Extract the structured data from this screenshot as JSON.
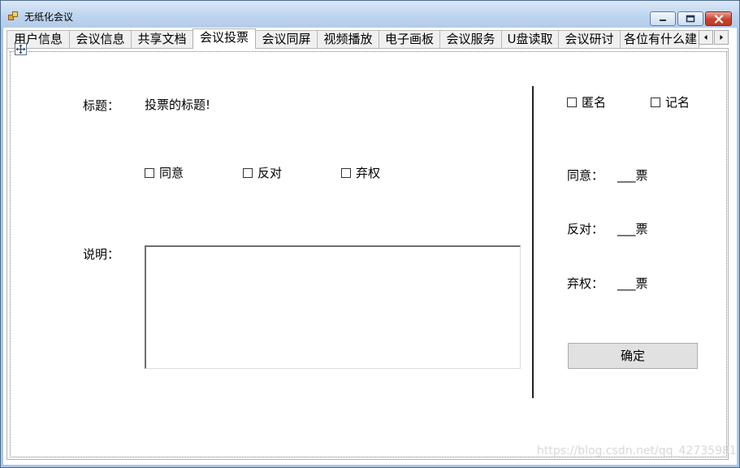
{
  "window": {
    "title": "无纸化会议",
    "icon": "app-icon"
  },
  "tabs": [
    {
      "label": "用户信息",
      "active": false
    },
    {
      "label": "会议信息",
      "active": false
    },
    {
      "label": "共享文档",
      "active": false
    },
    {
      "label": "会议投票",
      "active": true
    },
    {
      "label": "会议同屏",
      "active": false
    },
    {
      "label": "视频播放",
      "active": false
    },
    {
      "label": "电子画板",
      "active": false
    },
    {
      "label": "会议服务",
      "active": false
    },
    {
      "label": "U盘读取",
      "active": false
    },
    {
      "label": "会议研讨",
      "active": false
    },
    {
      "label": "各位有什么建",
      "active": false
    }
  ],
  "vote_form": {
    "title_label": "标题：",
    "title_value": "投票的标题!",
    "options": [
      {
        "label": "同意",
        "checked": false
      },
      {
        "label": "反对",
        "checked": false
      },
      {
        "label": "弃权",
        "checked": false
      }
    ],
    "description_label": "说明：",
    "description_value": ""
  },
  "side_panel": {
    "anonymous_label": "匿名",
    "anonymous_checked": false,
    "named_label": "记名",
    "named_checked": false,
    "results": [
      {
        "label": "同意：",
        "value": "___票"
      },
      {
        "label": "反对：",
        "value": "___票"
      },
      {
        "label": "弃权：",
        "value": "___票"
      }
    ],
    "confirm_label": "确定"
  },
  "watermark": "https://blog.csdn.net/qq_42735981"
}
